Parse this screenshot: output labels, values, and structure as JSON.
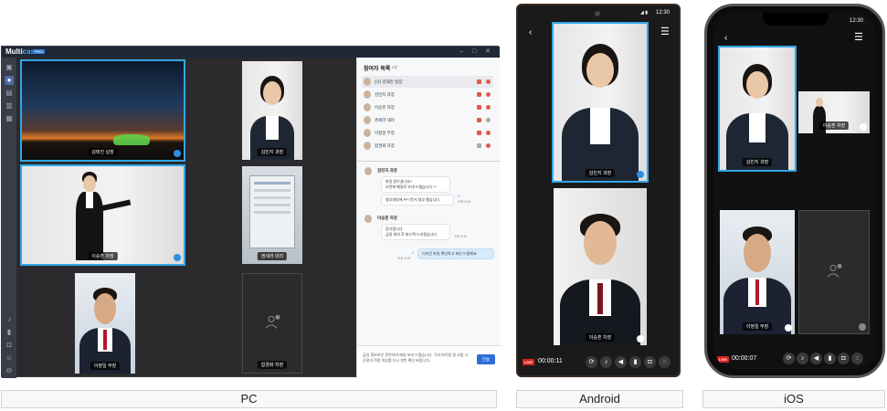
{
  "pc": {
    "logo_main": "Multi",
    "logo_accent": "cast",
    "logo_badge": "PRO",
    "window_controls": "– □ ✕",
    "tiles": [
      {
        "label": "김태진 실장"
      },
      {
        "label": "김민지 과장"
      },
      {
        "label": "이승훈 차장"
      },
      {
        "label": "권세라 대리"
      },
      {
        "label": "이정일 부장"
      },
      {
        "label": "함경화 차장"
      }
    ],
    "participants": {
      "title": "참여자 목록",
      "count": "6명",
      "rows": [
        {
          "name": "(나) 김태진 실장"
        },
        {
          "name": "김민지 과장"
        },
        {
          "name": "이승훈 차장"
        },
        {
          "name": "권세라 대리"
        },
        {
          "name": "이정일 부장"
        },
        {
          "name": "함경화 차장"
        }
      ]
    },
    "chat": {
      "msg1_name": "김민지 과장",
      "msg1_line1": "파일 받으셨나요?",
      "msg1_line2": "오전에 메일로 보내 드렸습니다 ^^",
      "msg1_line3": "첨부파일에 PPT문서 첨부 했습니다.",
      "msg1_unread": "2",
      "msg1_time": "오후 3:25",
      "msg2_name": "이승훈 차장",
      "msg2_line1": "감사합니다.",
      "msg2_line2": "금일 회의 후 피드백 드리겠습니다.",
      "msg2_time": "오후 3:32",
      "msg3_text": "디자인 파일 확인하고 회신 드릴께요.",
      "msg3_unread": "1",
      "msg3_time": "오후 3:35",
      "input_text": "금일 정보보안 관련하여 메일 보내 드렸습니다. 각자 마이칩 및 사람 시간관리 적정 여부를 다시 한번 확인 바랍니다.",
      "send_label": "전송"
    }
  },
  "android": {
    "time": "12:30",
    "tiles": [
      {
        "label": "김민지 과장"
      },
      {
        "label": "이승훈 차장"
      }
    ],
    "live": "LIVE",
    "timer": "00:00:11"
  },
  "ios": {
    "time": "12:30",
    "tiles": [
      {
        "label": "김민지 과장"
      },
      {
        "label": "이승훈 차장"
      },
      {
        "label": "이정일 부장"
      }
    ],
    "live": "LIVE",
    "timer": "00:00:07"
  },
  "captions": {
    "pc": "PC",
    "android": "Android",
    "ios": "iOS"
  },
  "colors": {
    "accent": "#32a6e8",
    "live": "#d9231f",
    "send": "#2d6fd6"
  }
}
